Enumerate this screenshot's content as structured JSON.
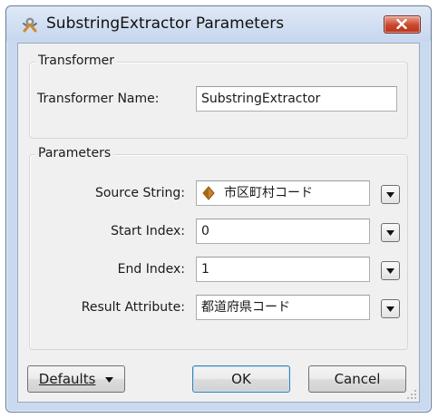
{
  "window": {
    "title": "SubstringExtractor Parameters",
    "icon": "transformer-icon",
    "close_icon": "close-icon"
  },
  "transformer_group": {
    "label": "Transformer",
    "name_label": "Transformer Name:",
    "name_value": "SubstringExtractor"
  },
  "parameters_group": {
    "label": "Parameters",
    "fields": [
      {
        "label": "Source String:",
        "value": "市区町村コード",
        "icon": "attribute-diamond-icon",
        "icon_color": "#c9822d"
      },
      {
        "label": "Start Index:",
        "value": "0"
      },
      {
        "label": "End Index:",
        "value": "1"
      },
      {
        "label": "Result Attribute:",
        "value": "都道府県コード"
      }
    ]
  },
  "buttons": {
    "defaults_label": "Defaults",
    "ok_label": "OK",
    "cancel_label": "Cancel"
  },
  "colors": {
    "window_frame": "#c9daf0",
    "close_button": "#c9462c",
    "dialog_bg": "#f0f0f0"
  }
}
